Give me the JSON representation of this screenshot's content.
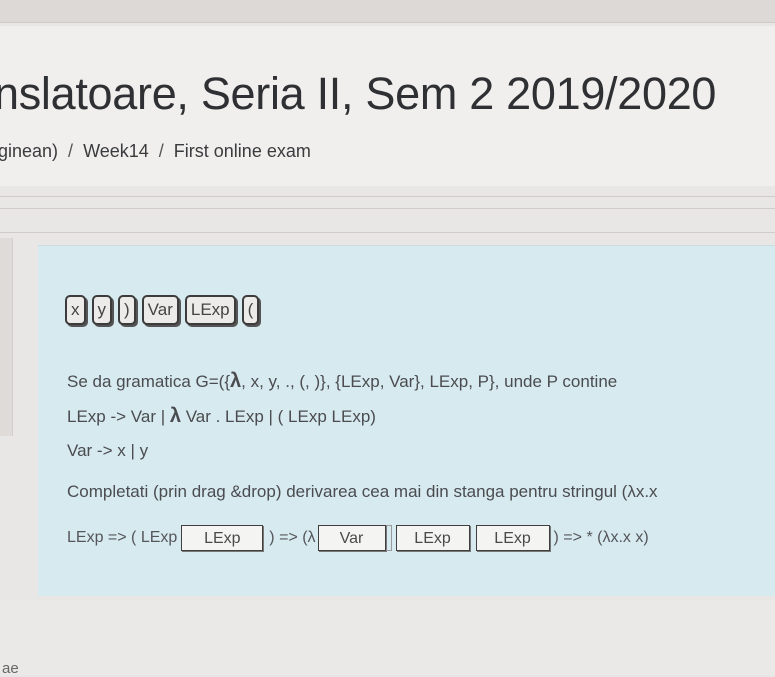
{
  "page": {
    "title": "nslatoare, Seria II, Sem 2 2019/2020",
    "bottom_fragment": "ae"
  },
  "breadcrumb": {
    "items": [
      "ginean)",
      "Week14",
      "First online exam"
    ],
    "separator": "/"
  },
  "question": {
    "palette": [
      "x",
      "y",
      ")",
      "Var",
      "LExp",
      "("
    ],
    "line1_prefix": "Se da gramatica G=({",
    "line1_lambda": "λ",
    "line1_suffix": ", x, y, ., (, )}, {LExp, Var}, LExp, P}, unde P contine",
    "line2_prefix": "LExp -> Var | ",
    "line2_lambda": "λ",
    "line2_suffix": " Var . LExp | ( LExp LExp)",
    "line3": "Var -> x | y",
    "line4": "Completati (prin drag &drop) derivarea cea mai din stanga pentru stringul (λx.x",
    "derivation": {
      "start": "LExp => ( LExp",
      "box1": "LExp",
      "mid1": ") => (λ",
      "box2": "Var",
      "box3": "LExp",
      "box4": "LExp",
      "end": ") => * (λx.x  x)"
    }
  }
}
